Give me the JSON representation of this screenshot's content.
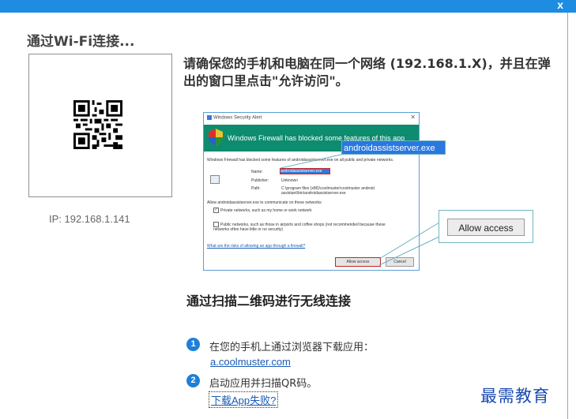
{
  "window": {
    "close_label": "x"
  },
  "heading": "通过Wi-Fi连接...",
  "ip_label": "IP: 192.168.1.141",
  "instruction": "请确保您的手机和电脑在同一个网络 (192.168.1.X)，并且在弹出的窗口里点击\"允许访问\"。",
  "dialog": {
    "title": "Windows Security Alert",
    "banner": "Windows Firewall has blocked some features of this app",
    "intro": "Windows Firewall has blocked some features of androidassistserver.exe on all public and private networks.",
    "name_label": "Name:",
    "name_value": "androidassistserver.exe",
    "publisher_label": "Publisher:",
    "publisher_value": "Unknown",
    "path_label": "Path:",
    "path_value": "C:\\program files (x86)\\coolmuster\\coolmuster android assistant\\bin\\androidassistserver.exe",
    "allow_prompt": "Allow androidassistserver.exe to communicate on these networks:",
    "private_option": "Private networks, such as my home or work network",
    "public_option": "Public networks, such as those in airports and coffee shops (not recommended because these networks often have little or no security)",
    "risk_link": "What are the risks of allowing an app through a firewall?",
    "allow_btn": "Allow access",
    "cancel_btn": "Cancel"
  },
  "callout_name": "androidassistserver.exe",
  "callout_allow": "Allow access",
  "subhead": "通过扫描二维码进行无线连接",
  "steps": [
    {
      "num": "1",
      "text": "在您的手机上通过浏览器下载应用：",
      "link": "a.coolmuster.com"
    },
    {
      "num": "2",
      "text": "启动应用并扫描QR码。",
      "link": "下载App失败?"
    }
  ],
  "watermark": "最需教育",
  "colors": {
    "titlebar": "#1e8ce0",
    "accent": "#1e7fd8",
    "banner": "#0d8c6f"
  }
}
